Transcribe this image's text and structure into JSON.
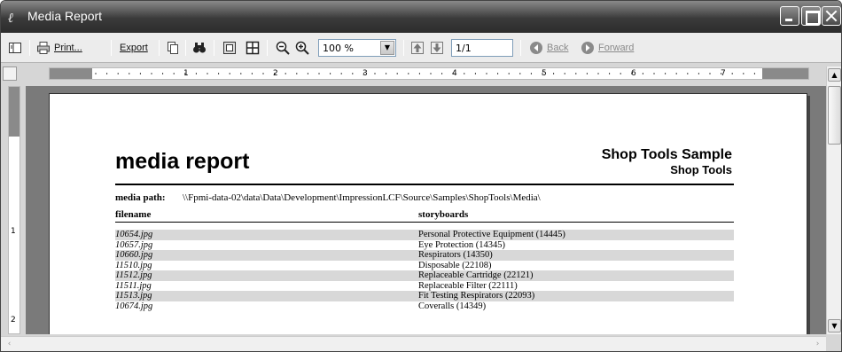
{
  "window": {
    "title": "Media Report"
  },
  "toolbar": {
    "print_label": "Print...",
    "export_label": "Export",
    "zoom_value": "100 %",
    "page_value": "1/1",
    "back_label": "Back",
    "forward_label": "Forward"
  },
  "ruler": {
    "numbers": [
      "1",
      "2",
      "3",
      "4",
      "5",
      "6",
      "7"
    ],
    "vnumbers": [
      "1",
      "2"
    ]
  },
  "report": {
    "title": "media report",
    "brand": "Shop Tools Sample",
    "subtitle": "Shop Tools",
    "media_path_label": "media path:",
    "media_path_value": "\\\\Fpmi-data-02\\data\\Data\\Development\\ImpressionLCF\\Source\\Samples\\ShopTools\\Media\\",
    "columns": {
      "filename": "filename",
      "storyboards": "storyboards"
    },
    "rows": [
      {
        "filename": "10654.jpg",
        "storyboards": "Personal Protective Equipment (14445)"
      },
      {
        "filename": "10657.jpg",
        "storyboards": "Eye Protection (14345)"
      },
      {
        "filename": "10660.jpg",
        "storyboards": "Respirators (14350)"
      },
      {
        "filename": "11510.jpg",
        "storyboards": "Disposable (22108)"
      },
      {
        "filename": "11512.jpg",
        "storyboards": "Replaceable Cartridge (22121)"
      },
      {
        "filename": "11511.jpg",
        "storyboards": "Replaceable Filter (22111)"
      },
      {
        "filename": "11513.jpg",
        "storyboards": "Fit Testing Respirators (22093)"
      },
      {
        "filename": "10674.jpg",
        "storyboards": "Coveralls (14349)"
      }
    ]
  }
}
